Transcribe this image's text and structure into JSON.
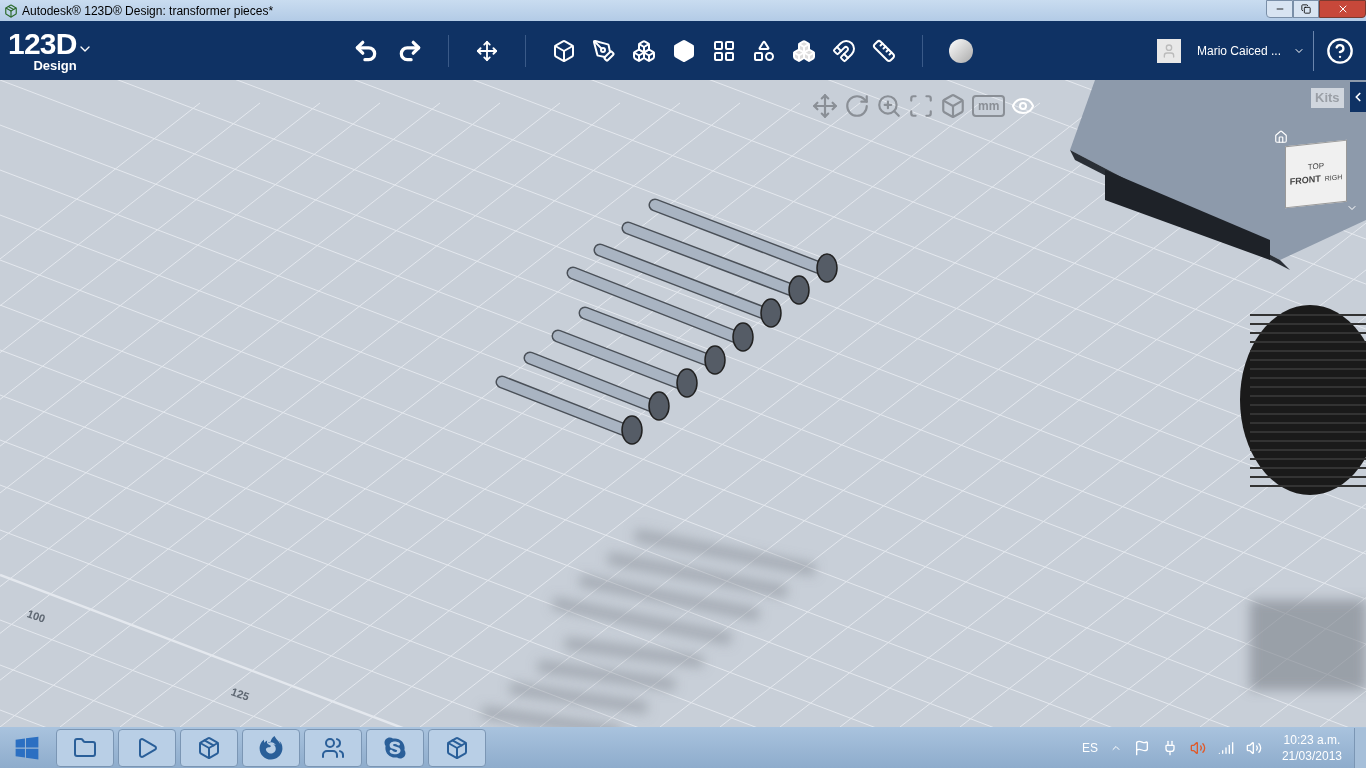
{
  "window": {
    "title": "Autodesk® 123D® Design: transformer pieces*"
  },
  "app": {
    "logo": "123D",
    "logo_sub": "Design",
    "user": "Mario Caiced ..."
  },
  "viewport": {
    "units": "mm",
    "kits": "Kits",
    "axis_labels": [
      "100",
      "125"
    ],
    "view_cube": {
      "top": "TOP",
      "front": "FRONT",
      "right": "RIGH"
    }
  },
  "taskbar": {
    "language": "ES",
    "time": "10:23 a.m.",
    "date": "21/03/2013"
  }
}
